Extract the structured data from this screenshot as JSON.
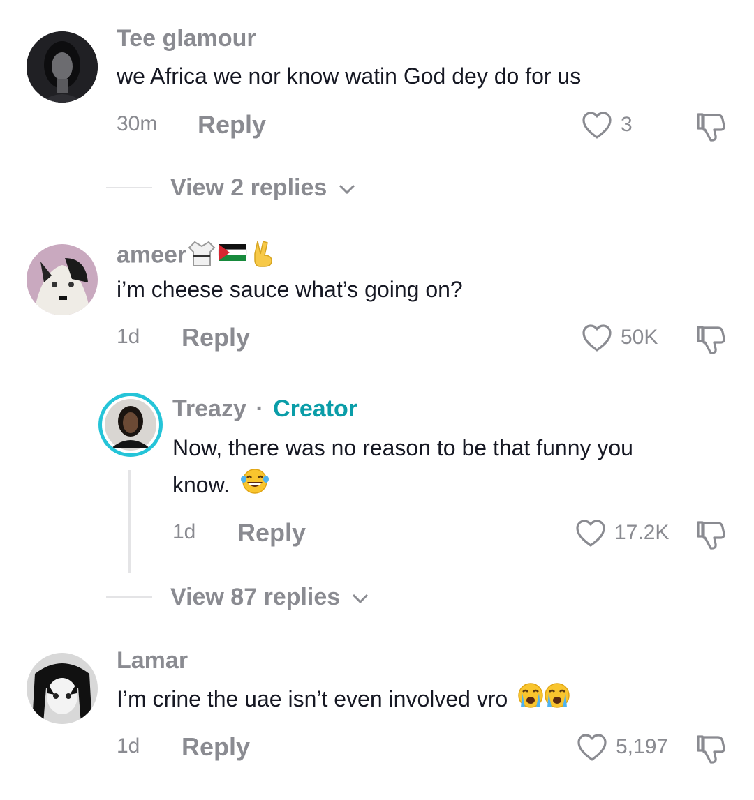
{
  "comments": [
    {
      "username": "Tee glamour",
      "text": "we Africa we nor know watin God dey do for us",
      "time": "30m",
      "reply_label": "Reply",
      "likes": "3",
      "view_replies": "View 2 replies"
    },
    {
      "username": "ameer",
      "text": "i’m cheese sauce what’s going on?",
      "time": "1d",
      "reply_label": "Reply",
      "likes": "50K",
      "reply": {
        "username": "Treazy",
        "separator": "·",
        "badge": "Creator",
        "text_line1": "Now, there was no reason to be that funny you",
        "text_line2": "know.",
        "time": "1d",
        "reply_label": "Reply",
        "likes": "17.2K"
      },
      "view_replies": "View 87 replies"
    },
    {
      "username": "Lamar",
      "text": "I’m crine the uae isn’t even involved vro",
      "time": "1d",
      "reply_label": "Reply",
      "likes": "5,197"
    }
  ],
  "colors": {
    "creator_accent": "#0a9da8",
    "ring_accent": "#25c4d8",
    "muted": "#8a8b91"
  },
  "icons": [
    "heart-icon",
    "dislike-icon",
    "chevron-down-icon",
    "laughing-emoji",
    "crying-emoji",
    "gi-emoji",
    "flag-emoji",
    "peace-hand-emoji"
  ]
}
